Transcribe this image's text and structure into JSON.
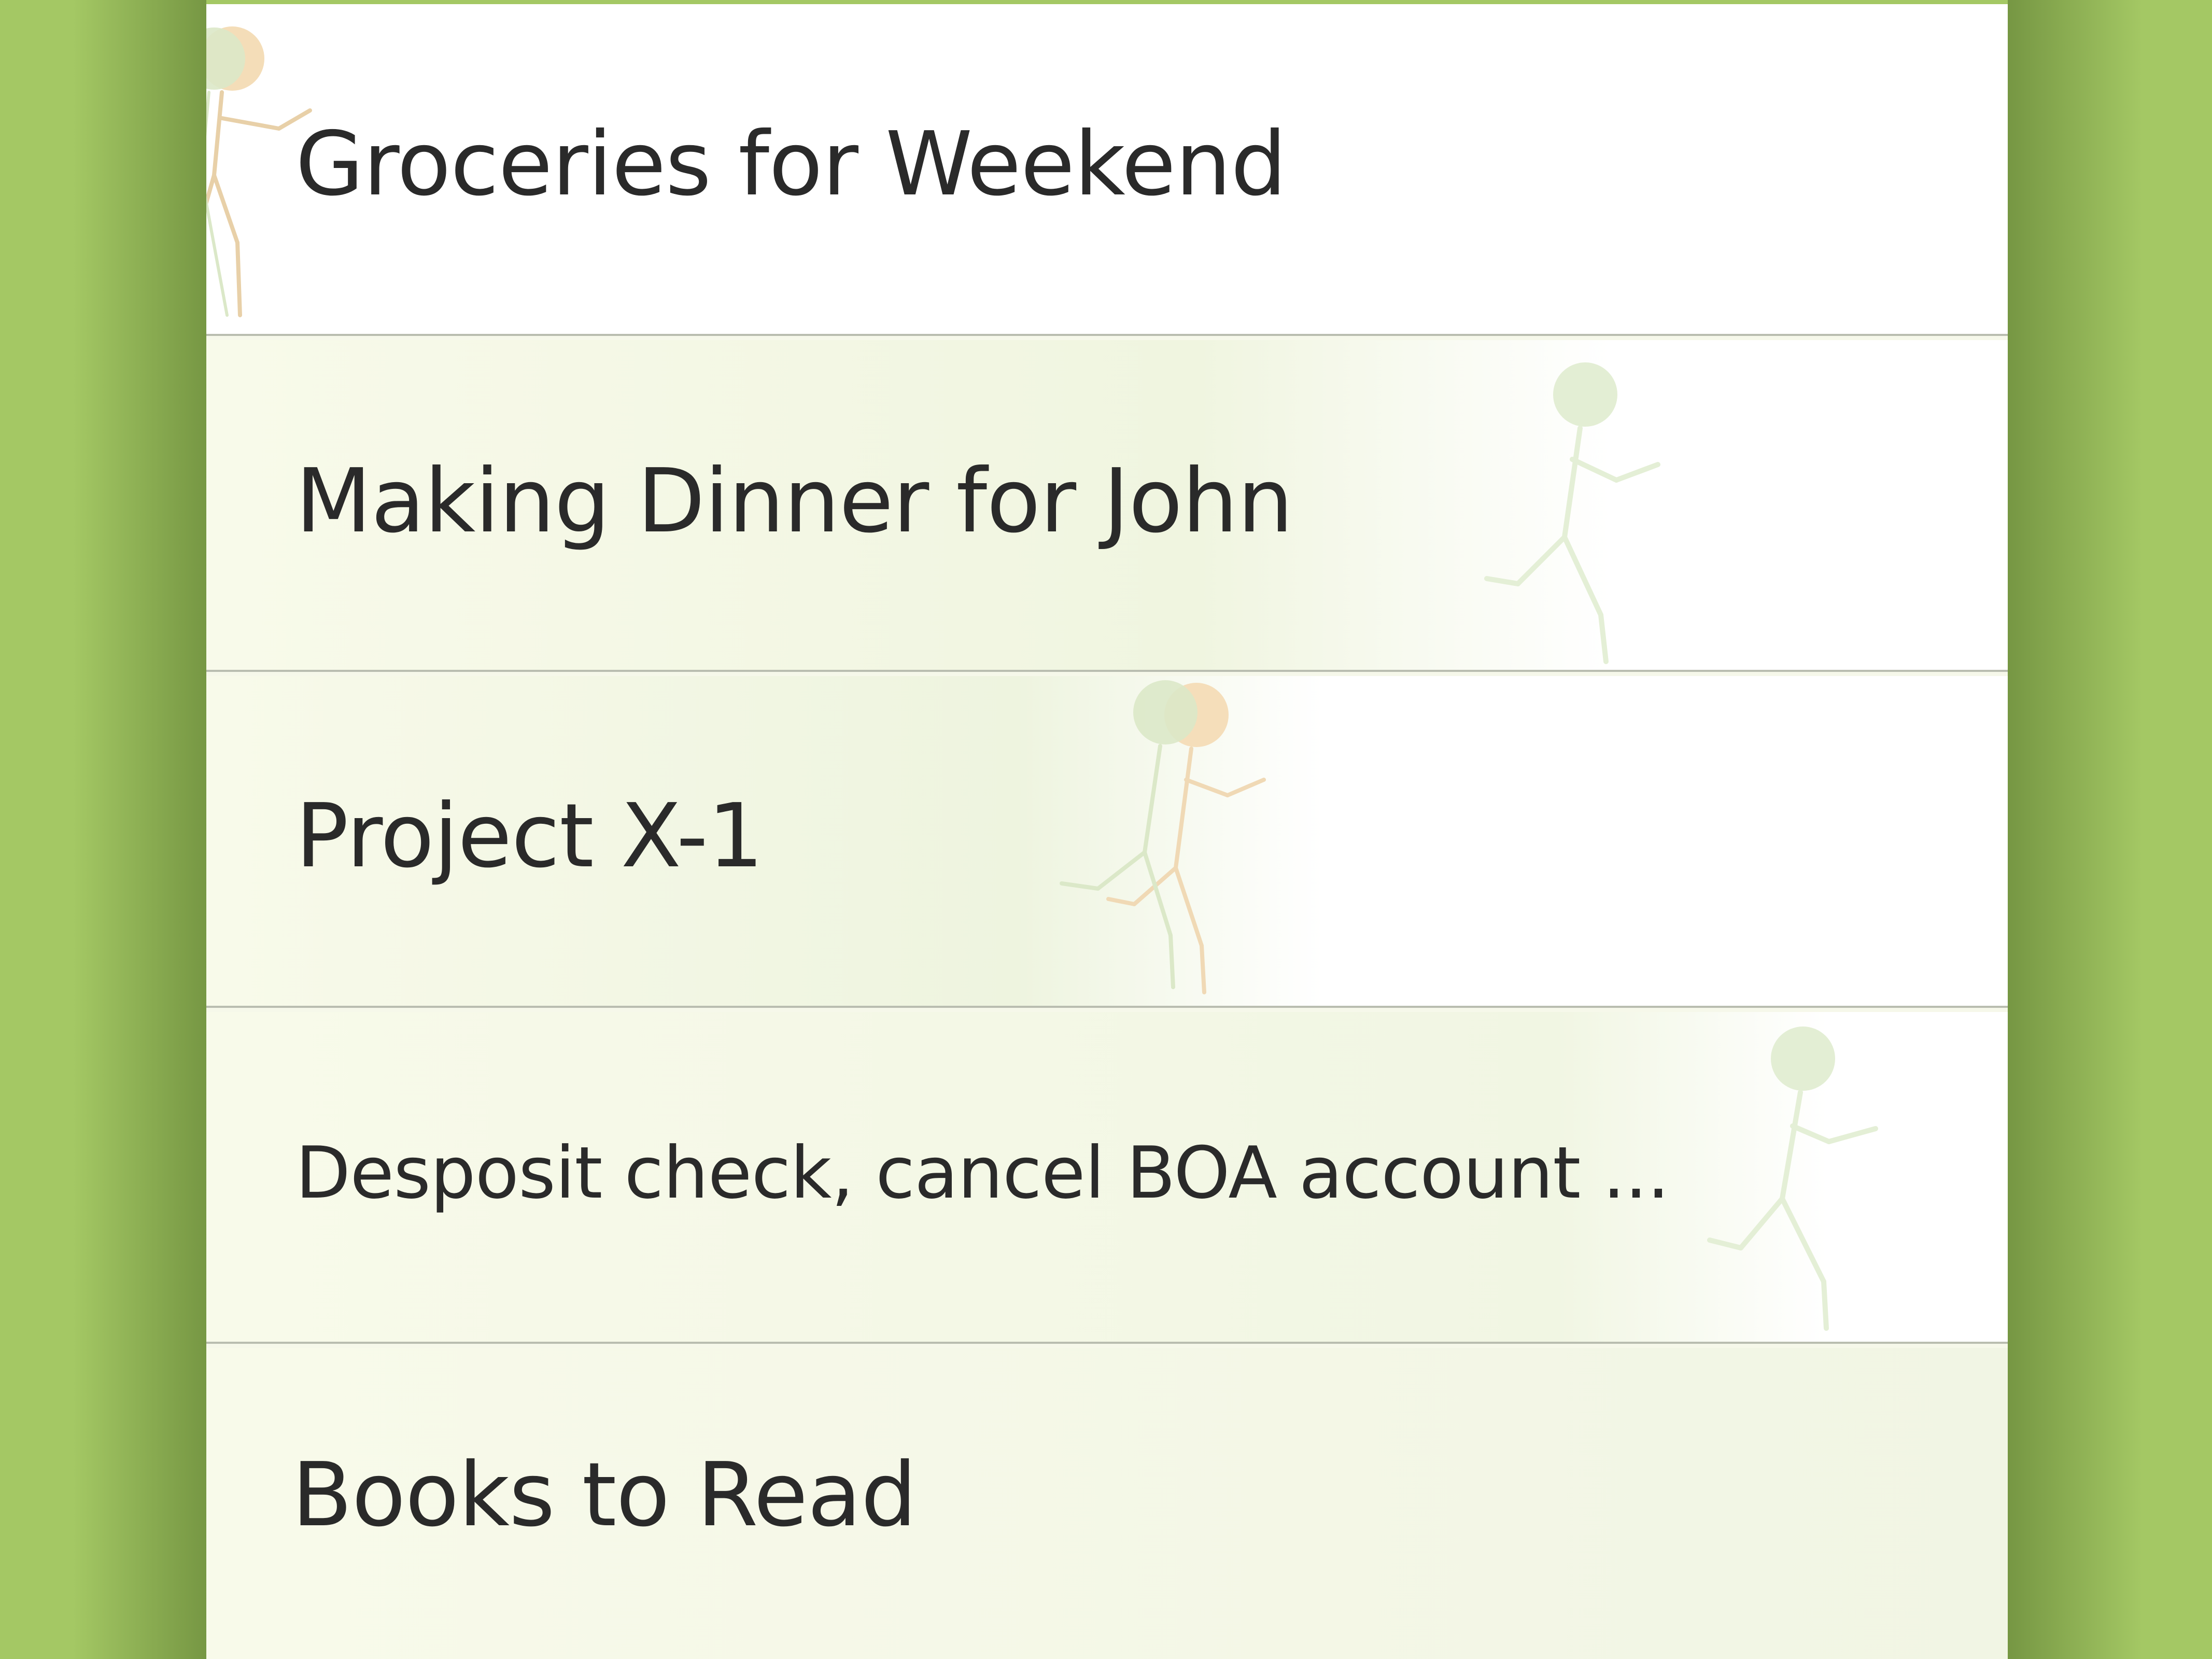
{
  "app": {
    "accent_color": "#a4c864",
    "divider_color": "#b9bdb0",
    "text_color": "#2a2a2a"
  },
  "list": {
    "items": [
      {
        "label": "Groceries for Weekend",
        "decoration": "runner-icon"
      },
      {
        "label": "Making Dinner for John",
        "decoration": "runner-icon"
      },
      {
        "label": "Project X-1",
        "decoration": "runner-icon"
      },
      {
        "label": "Desposit check, cancel BOA account ...",
        "decoration": "runner-icon"
      },
      {
        "label": "Books to Read",
        "decoration": "none"
      }
    ]
  }
}
